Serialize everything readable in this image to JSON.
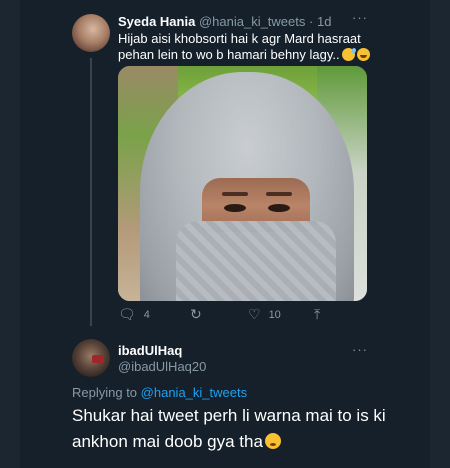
{
  "tweet": {
    "author_name": "Syeda Hania",
    "author_handle": "@hania_ki_tweets",
    "separator": "·",
    "time": "1d",
    "more_icon": "more-dots-icon",
    "text": "Hijab aisi khobsorti hai k agr Mard hasraat pehan lein to wo b hamari behny lagy..",
    "emojis": [
      "sweat-smile-emoji",
      "laughing-emoji"
    ],
    "image_alt": "",
    "actions": {
      "reply_count": "4",
      "retweet_count": "",
      "like_count": "10",
      "reply_icon": "reply-icon",
      "retweet_icon": "retweet-icon",
      "like_icon": "heart-icon",
      "share_icon": "share-icon"
    }
  },
  "reply": {
    "author_name": "ibadUlHaq",
    "author_handle": "@ibadUlHaq20",
    "replying_label": "Replying to",
    "replying_handle": "@hania_ki_tweets",
    "text": "Shukar hai tweet perh li warna mai to is ki ankhon mai doob gya tha",
    "emoji": "flushed-face-emoji"
  },
  "colors": {
    "background": "#15202b",
    "secondary_text": "#8899a6",
    "link": "#1da1f2"
  }
}
